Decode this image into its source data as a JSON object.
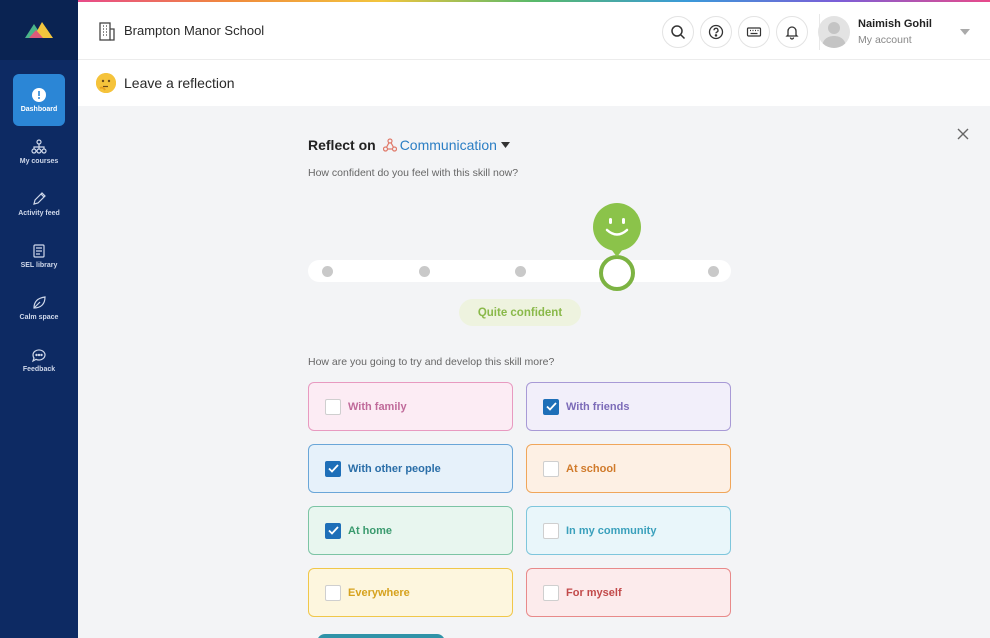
{
  "header": {
    "school_name": "Brampton Manor School",
    "icons": [
      "search-icon",
      "help-icon",
      "keyboard-icon",
      "bell-icon"
    ],
    "account": {
      "name": "Naimish Gohil",
      "subtitle": "My account"
    }
  },
  "sidebar": {
    "items": [
      {
        "label": "Dashboard",
        "icon": "dashboard-icon",
        "active": true
      },
      {
        "label": "My courses",
        "icon": "courses-icon",
        "active": false
      },
      {
        "label": "Activity feed",
        "icon": "pencil-icon",
        "active": false
      },
      {
        "label": "SEL library",
        "icon": "library-icon",
        "active": false
      },
      {
        "label": "Calm space",
        "icon": "leaf-icon",
        "active": false
      },
      {
        "label": "Feedback",
        "icon": "chat-icon",
        "active": false
      }
    ]
  },
  "page": {
    "title": "Leave a reflection"
  },
  "reflection": {
    "reflect_label": "Reflect on",
    "skill": "Communication",
    "confidence_question": "How confident do you feel with this skill now?",
    "confidence_level": 4,
    "confidence_max": 5,
    "confidence_label": "Quite confident",
    "develop_question": "How are you going to try and develop this skill more?",
    "options": [
      {
        "label": "With family",
        "checked": false,
        "border": "#e89ac0",
        "bg": "#fcecf4",
        "text": "#c06a9a"
      },
      {
        "label": "With friends",
        "checked": true,
        "border": "#a89ad6",
        "bg": "#f2effa",
        "text": "#7c6bb8"
      },
      {
        "label": "With other people",
        "checked": true,
        "border": "#6aa6d8",
        "bg": "#e6f1fa",
        "text": "#2a6ea8"
      },
      {
        "label": "At school",
        "checked": false,
        "border": "#f0a65a",
        "bg": "#fdf0e4",
        "text": "#d07a2a"
      },
      {
        "label": "At home",
        "checked": true,
        "border": "#7cc4a4",
        "bg": "#e8f6ef",
        "text": "#3a9a6e"
      },
      {
        "label": "In my community",
        "checked": false,
        "border": "#7ec6dc",
        "bg": "#e9f6fa",
        "text": "#3aa0bc"
      },
      {
        "label": "Everywhere",
        "checked": false,
        "border": "#f0c74a",
        "bg": "#fdf6de",
        "text": "#d6a21e"
      },
      {
        "label": "For myself",
        "checked": false,
        "border": "#e88a8a",
        "bg": "#fcebec",
        "text": "#c24a4a"
      }
    ]
  }
}
